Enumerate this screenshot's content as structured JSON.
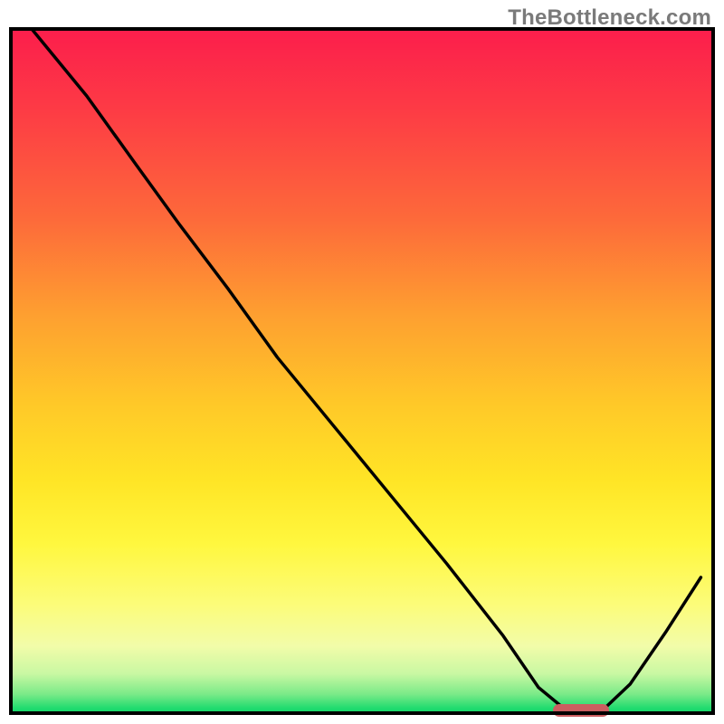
{
  "watermark": "TheBottleneck.com",
  "colors": {
    "frame": "#000000",
    "curve": "#000000",
    "marker": "#cb5e60",
    "gradient_stops": [
      "#fc1d4c",
      "#fd3b45",
      "#fd6a3a",
      "#fea030",
      "#ffc928",
      "#ffe526",
      "#fff73e",
      "#fcfc7a",
      "#f2fca9",
      "#c9f8a3",
      "#7aea88",
      "#21db6f",
      "#0fd868"
    ]
  },
  "chart_data": {
    "type": "line",
    "title": "",
    "xlabel": "",
    "ylabel": "",
    "xlim": [
      0,
      100
    ],
    "ylim": [
      0,
      100
    ],
    "grid": false,
    "legend": false,
    "notes": "Unlabeled axes; x and y expressed as 0–100 percent of the plot area (x left→right, y bottom→top). Gradient background red (top) to green (bottom). Curve is the black line; marker is the small pink/red capsule near the minimum.",
    "series": [
      {
        "name": "curve",
        "x": [
          3.0,
          11.0,
          18.0,
          24.0,
          31.0,
          38.0,
          46.0,
          54.0,
          62.0,
          70.0,
          75.0,
          79.0,
          84.0,
          88.0,
          93.0,
          98.0
        ],
        "y": [
          100.0,
          90.0,
          80.0,
          71.5,
          62.0,
          52.0,
          42.0,
          32.0,
          22.0,
          11.5,
          4.0,
          0.6,
          0.6,
          4.5,
          12.0,
          20.0
        ]
      }
    ],
    "marker": {
      "x_start": 77.0,
      "x_end": 85.0,
      "y": 0.6,
      "shape": "capsule"
    }
  }
}
